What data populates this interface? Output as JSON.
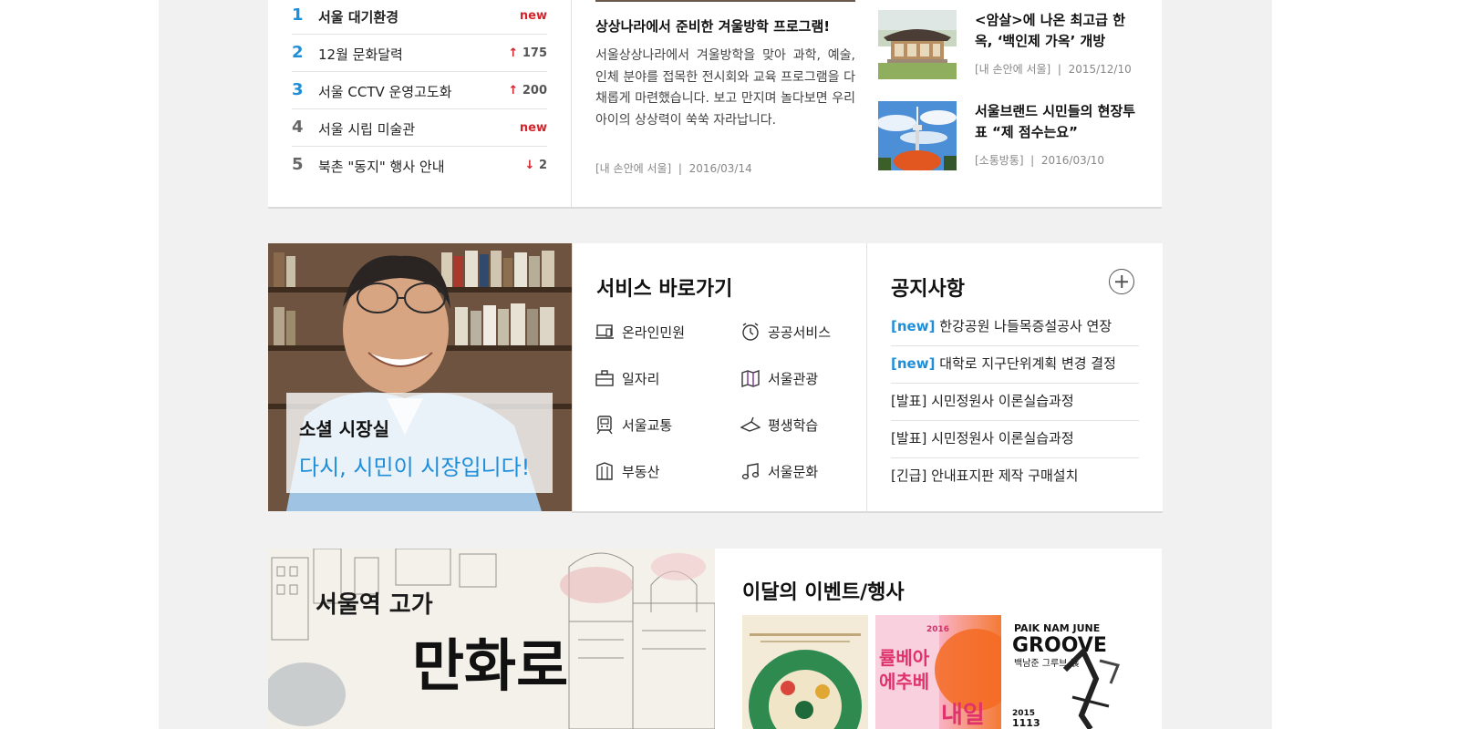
{
  "ranking": {
    "items": [
      {
        "rank": "1",
        "text": "서울 대기환경",
        "change": "new",
        "type": "new"
      },
      {
        "rank": "2",
        "text": "12월 문화달력",
        "change": "175",
        "type": "up"
      },
      {
        "rank": "3",
        "text": "서울 CCTV 운영고도화",
        "change": "200",
        "type": "up"
      },
      {
        "rank": "4",
        "text": "서울 시립 미술관",
        "change": "new",
        "type": "new"
      },
      {
        "rank": "5",
        "text": "북촌 \"동지\" 행사 안내",
        "change": "2",
        "type": "down"
      }
    ]
  },
  "news_main": {
    "title": "상상나라에서 준비한 겨울방학 프로그램!",
    "body": "서울상상나라에서 겨울방학을 맞아 과학, 예술, 인체 분야를 접목한 전시회와 교육 프로그램을 다채롭게 마련했습니다. 보고 만지며 놀다보면 우리 아이의 상상력이 쑥쑥 자라납니다.",
    "category": "[내 손안에 서울]",
    "date": "2016/03/14"
  },
  "side_news": [
    {
      "title": "<암살>에 나온 최고급 한옥, ‘백인제 가옥’ 개방",
      "category": "[내 손안에 서울]",
      "date": "2015/12/10"
    },
    {
      "title": "서울브랜드 시민들의 현장투표 “제 점수는요”",
      "category": "[소통방통]",
      "date": "2016/03/10"
    }
  ],
  "meta_separator": "|",
  "mayor": {
    "title": "소셜 시장실",
    "slogan": "다시, 시민이 시장입니다!"
  },
  "services": {
    "heading": "서비스 바로가기",
    "items": [
      {
        "label": "온라인민원",
        "icon": "laptop-icon"
      },
      {
        "label": "공공서비스",
        "icon": "alarm-clock-icon"
      },
      {
        "label": "일자리",
        "icon": "briefcase-icon"
      },
      {
        "label": "서울관광",
        "icon": "map-icon"
      },
      {
        "label": "서울교통",
        "icon": "train-icon"
      },
      {
        "label": "평생학습",
        "icon": "graduation-cap-icon"
      },
      {
        "label": "부동산",
        "icon": "building-icon"
      },
      {
        "label": "서울문화",
        "icon": "music-note-icon"
      }
    ]
  },
  "notices": {
    "heading": "공지사항",
    "items": [
      {
        "tag": "[new]",
        "text": "한강공원 나들목증설공사 연장"
      },
      {
        "tag": "[new]",
        "text": "대학로 지구단위계획 변경 결정"
      },
      {
        "tag": "",
        "text": "[발표] 시민정원사 이론실습과정"
      },
      {
        "tag": "",
        "text": "[발표] 시민정원사 이론실습과정"
      },
      {
        "tag": "",
        "text": "[긴급] 안내표지판 제작 구매설치"
      }
    ]
  },
  "cartoon": {
    "line1": "서울역 고가",
    "line2": "만화로"
  },
  "events": {
    "heading": "이달의 이벤트/행사",
    "poster3_title": "PAIK NAM JUNE",
    "poster3_sub": "GROOVE",
    "poster3_kr": "백남준 그루브 展",
    "poster3_year": "2015",
    "poster3_date": "1113",
    "poster2_year": "2016",
    "poster2_vert1": "률베아",
    "poster2_vert2": "에추베",
    "poster2_big": "내일"
  },
  "colors": {
    "accent_blue": "#1e8ed9",
    "accent_red": "#d2252b",
    "background": "#f1f1f1"
  }
}
